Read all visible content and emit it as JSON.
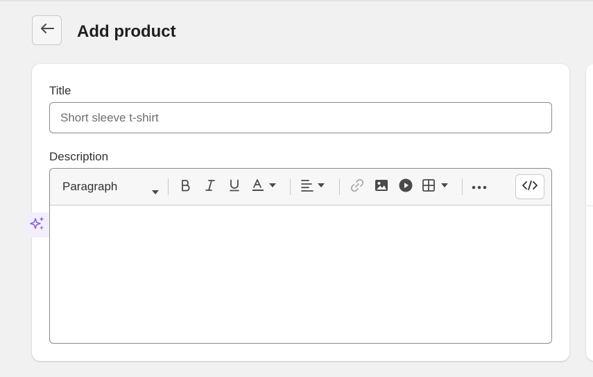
{
  "header": {
    "title": "Add product",
    "back_icon": "arrow-left-icon"
  },
  "form": {
    "title_label": "Title",
    "title_placeholder": "Short sleeve t-shirt",
    "title_value": "",
    "description_label": "Description"
  },
  "toolbar": {
    "paragraph_select": "Paragraph",
    "buttons": [
      "bold-icon",
      "italic-icon",
      "underline-icon",
      "text-color-icon",
      "align-icon",
      "link-icon",
      "image-icon",
      "video-icon",
      "table-icon",
      "more-icon",
      "code-icon"
    ]
  },
  "ai": {
    "icon": "sparkles-icon",
    "accent": "#8c5fd8"
  }
}
